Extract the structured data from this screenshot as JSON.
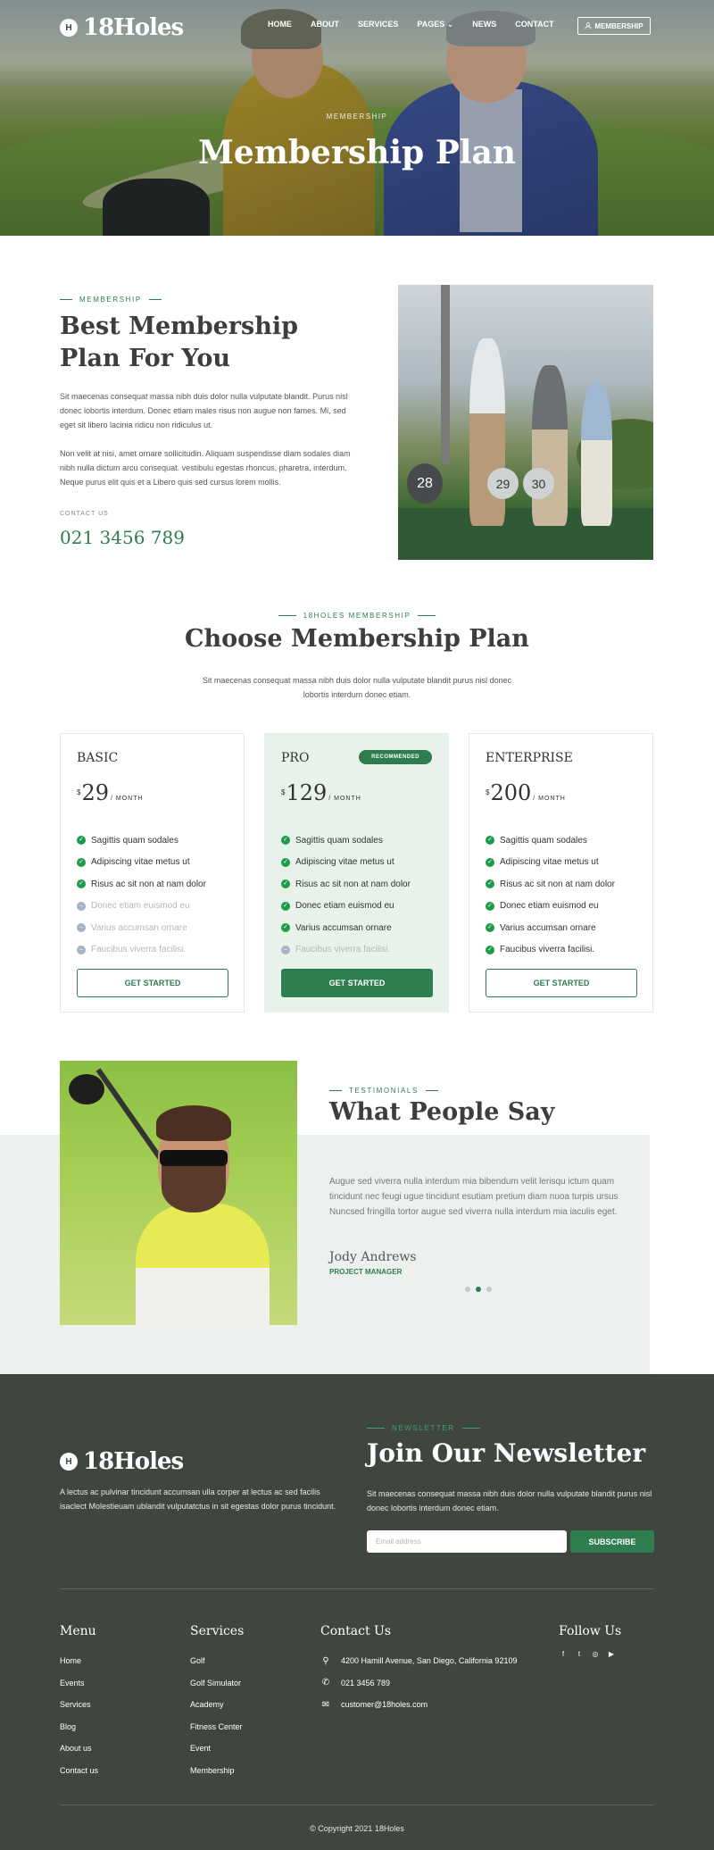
{
  "header": {
    "logo_mark": "H",
    "logo_text": "18Holes",
    "nav": [
      "HOME",
      "ABOUT",
      "SERVICES",
      "PAGES",
      "NEWS",
      "CONTACT"
    ],
    "membership_button": "MEMBERSHIP"
  },
  "hero": {
    "eyebrow": "MEMBERSHIP",
    "title": "Membership Plan"
  },
  "about": {
    "eyebrow": "MEMBERSHIP",
    "title_line1": "Best Membership",
    "title_line2": "Plan For You",
    "paragraph1": "Sit maecenas consequat massa nibh duis dolor nulla vulputate blandit. Purus nisl donec lobortis interdum. Donec etiam males risus non augue non fames. Mi, sed eget sit libero lacinia ridicu non ridiculus ut.",
    "paragraph2": "Non velit at nisi, amet ornare sollicitudin. Aliquam suspendisse diam sodales diam nibh nulla dictum arcu consequat. vestibulu egestas rhoncus, pharetra, interdum. Neque purus elit quis et a Libero quis sed cursus lorem mollis.",
    "contact_label": "CONTACT US",
    "phone": "021 3456 789",
    "image_numbers": [
      "28",
      "29",
      "30"
    ]
  },
  "plans": {
    "eyebrow": "18HOLES MEMBERSHIP",
    "title": "Choose Membership Plan",
    "description": "Sit maecenas consequat massa nibh duis dolor nulla vulputate blandit purus nisl donec lobortis interdum donec etiam.",
    "cards": [
      {
        "name": "BASIC",
        "currency": "$",
        "price": "29",
        "period": "/ MONTH",
        "features": [
          {
            "text": "Sagittis quam sodales",
            "included": true
          },
          {
            "text": "Adipiscing vitae metus ut",
            "included": true
          },
          {
            "text": "Risus ac sit non at nam dolor",
            "included": true
          },
          {
            "text": "Donec etiam euismod eu",
            "included": false
          },
          {
            "text": "Varius accumsan ornare",
            "included": false
          },
          {
            "text": "Faucibus viverra facilisi.",
            "included": false
          }
        ],
        "button": "GET STARTED"
      },
      {
        "name": "PRO",
        "badge": "RECOMMENDED",
        "currency": "$",
        "price": "129",
        "period": "/ MONTH",
        "features": [
          {
            "text": "Sagittis quam sodales",
            "included": true
          },
          {
            "text": "Adipiscing vitae metus ut",
            "included": true
          },
          {
            "text": "Risus ac sit non at nam dolor",
            "included": true
          },
          {
            "text": "Donec etiam euismod eu",
            "included": true
          },
          {
            "text": "Varius accumsan ornare",
            "included": true
          },
          {
            "text": "Faucibus viverra facilisi.",
            "included": false
          }
        ],
        "button": "GET STARTED"
      },
      {
        "name": "ENTERPRISE",
        "currency": "$",
        "price": "200",
        "period": "/ MONTH",
        "features": [
          {
            "text": "Sagittis quam sodales",
            "included": true
          },
          {
            "text": "Adipiscing vitae metus ut",
            "included": true
          },
          {
            "text": "Risus ac sit non at nam dolor",
            "included": true
          },
          {
            "text": "Donec etiam euismod eu",
            "included": true
          },
          {
            "text": "Varius accumsan ornare",
            "included": true
          },
          {
            "text": "Faucibus viverra facilisi.",
            "included": true
          }
        ],
        "button": "GET STARTED"
      }
    ]
  },
  "testimonial": {
    "eyebrow": "TESTIMONIALS",
    "title": "What People Say",
    "quote": "Augue sed viverra nulla interdum mia bibendum velit lerisqu ictum quam tincidunt nec feugi ugue tincidunt esutiam pretium diam nuoa turpis ursus Nuncsed fringilla tortor augue sed viverra nulla interdum mia iaculis eget.",
    "name": "Jody Andrews",
    "role": "PROJECT MANAGER",
    "active_dot": 2
  },
  "footer": {
    "logo_mark": "H",
    "logo_text": "18Holes",
    "about": "A lectus ac pulvinar tincidunt accumsan ulla corper at lectus ac sed facilis isaclect Molestieuam ublandit vulputatctus in sit egestas dolor purus tincidunt.",
    "newsletter": {
      "eyebrow": "NEWSLETTER",
      "title": "Join Our Newsletter",
      "description": "Sit maecenas consequat massa nibh duis dolor nulla vulputate blandit purus nisl donec lobortis interdum donec etiam.",
      "placeholder": "Email address",
      "button": "SUBSCRIBE"
    },
    "menu": {
      "title": "Menu",
      "items": [
        "Home",
        "Events",
        "Services",
        "Blog",
        "About us",
        "Contact us"
      ]
    },
    "services": {
      "title": "Services",
      "items": [
        "Golf",
        "Golf Simulator",
        "Academy",
        "Fitness Center",
        "Event",
        "Membership"
      ]
    },
    "contact": {
      "title": "Contact Us",
      "address": "4200 Hamill Avenue, San Diego, California 92109",
      "phone": "021 3456 789",
      "email": "customer@18holes.com"
    },
    "follow": {
      "title": "Follow Us",
      "icons": [
        "facebook-icon",
        "twitter-icon",
        "instagram-icon",
        "youtube-icon"
      ]
    },
    "copyright": "© Copyright 2021 18Holes"
  },
  "colors": {
    "accent": "#2e7d4f",
    "footer_bg": "#3f463f",
    "pro_card_bg": "#e8f1ea",
    "testimonial_bg": "#edf1ee"
  }
}
